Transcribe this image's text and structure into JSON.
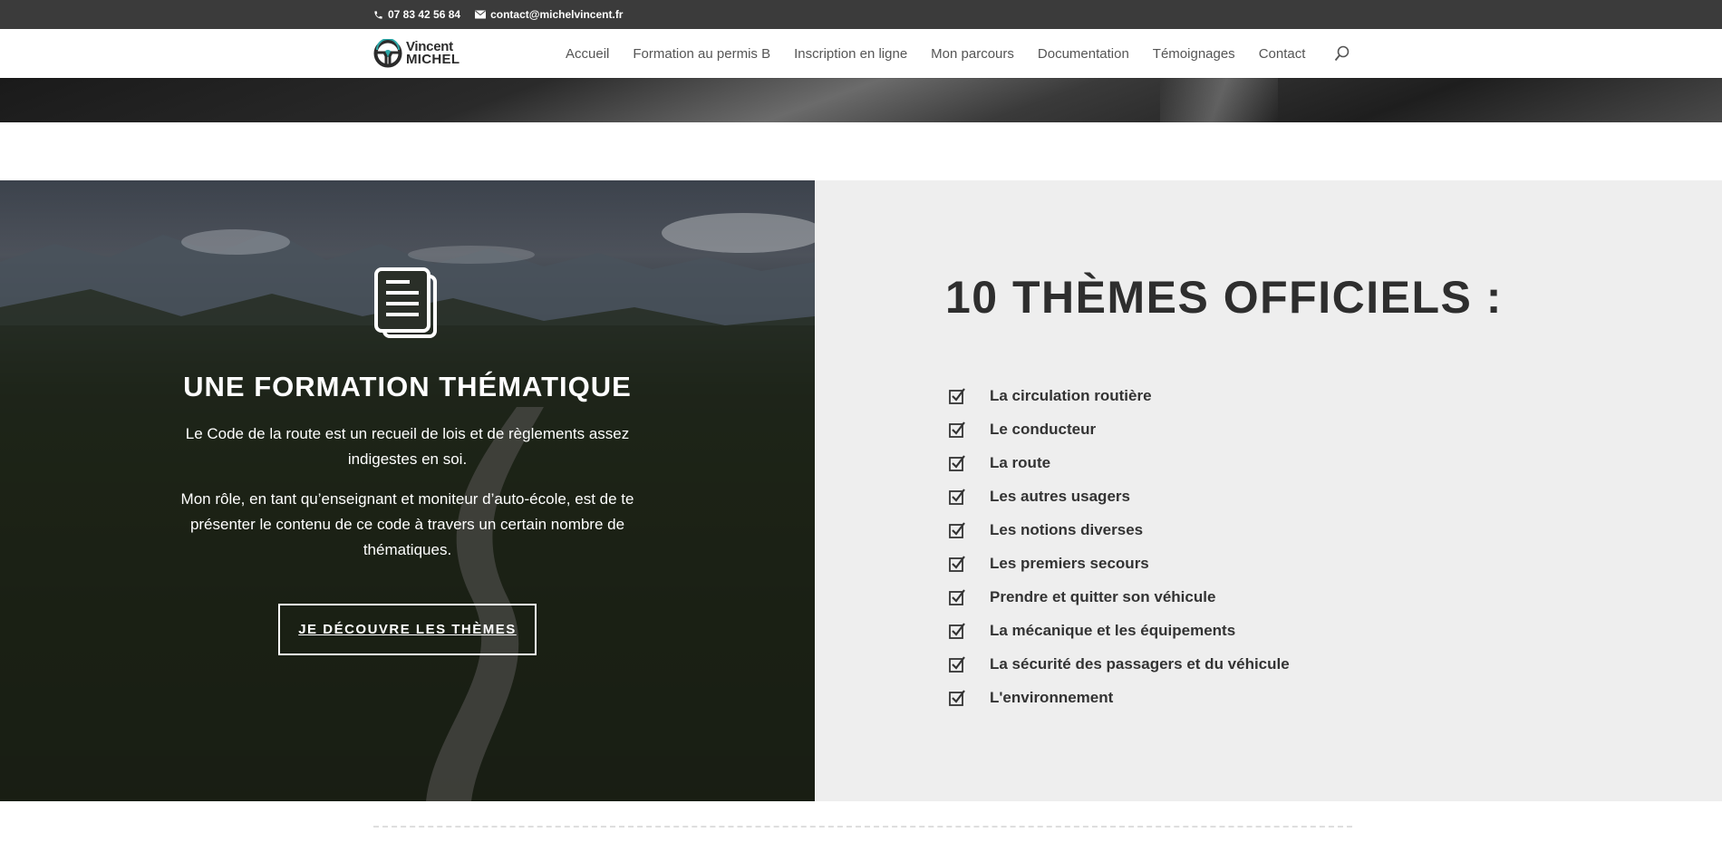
{
  "topbar": {
    "phone": "07 83 42 56 84",
    "email": "contact@michelvincent.fr"
  },
  "logo": {
    "line1": "Vincent",
    "line2": "MICHEL"
  },
  "nav": {
    "items": [
      {
        "label": "Accueil"
      },
      {
        "label": "Formation au permis B"
      },
      {
        "label": "Inscription en ligne"
      },
      {
        "label": "Mon parcours"
      },
      {
        "label": "Documentation"
      },
      {
        "label": "Témoignages"
      },
      {
        "label": "Contact"
      }
    ]
  },
  "left": {
    "title": "UNE FORMATION THÉMATIQUE",
    "paragraph1": "Le Code de la route est un recueil de lois et de règlements assez indigestes en soi.",
    "paragraph2": "Mon rôle, en tant qu’enseignant et moniteur d’auto-école, est de te présenter le contenu de ce code à travers un certain nombre de thématiques.",
    "button": "JE DÉCOUVRE LES THÈMES"
  },
  "right": {
    "title": "10 THÈMES OFFICIELS :",
    "themes": [
      "La circulation routière",
      "Le conducteur",
      "La route",
      "Les autres usagers",
      "Les notions diverses",
      "Les premiers secours",
      "Prendre et quitter son véhicule",
      "La mécanique et les équipements",
      "La sécurité des passagers et du véhicule",
      "L'environnement"
    ]
  },
  "colors": {
    "topbar_bg": "#3b3b3b",
    "accent": "#2aa6a6",
    "right_bg": "#eeeeee",
    "heading": "#2e2e2e"
  }
}
